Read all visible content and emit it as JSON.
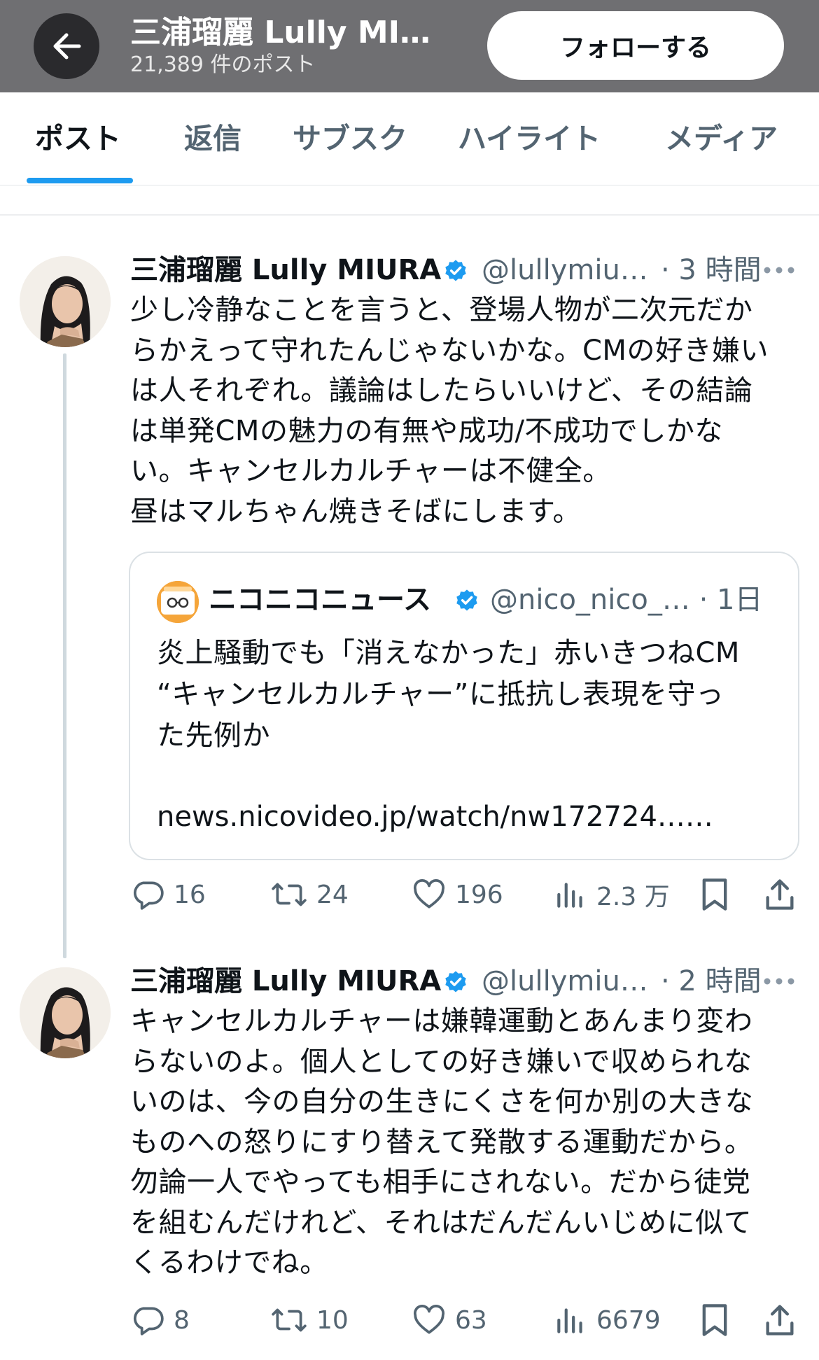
{
  "header": {
    "name": "三浦瑠麗 Lully MI…",
    "post_count": "21,389 件のポスト",
    "follow_label": "フォローする"
  },
  "tabs": [
    {
      "label": "ポスト",
      "active": true
    },
    {
      "label": "返信"
    },
    {
      "label": "サブスク"
    },
    {
      "label": "ハイライト"
    },
    {
      "label": "メディア"
    }
  ],
  "tweets": [
    {
      "name": "三浦瑠麗 Lully MIURA",
      "handle": "@lullymiu…",
      "time": "· 3 時間",
      "text": "少し冷静なことを言うと、登場人物が二次元だか\nらかえって守れたんじゃないかな。CMの好き嫌い\nは人それぞれ。議論はしたらいいけど、その結論\nは単発CMの魅力の有無や成功/不成功でしかな\nい。キャンセルカルチャーは不健全。\n昼はマルちゃん焼きそばにします。",
      "quote": {
        "name": "ニコニコニュース",
        "handle": "@nico_nico_… · 1日",
        "text": "炎上騒動でも「消えなかった」赤いきつねCM\n“キャンセルカルチャー”に抵抗し表現を守っ\nた先例か",
        "link": "news.nicovideo.jp/watch/nw172724……"
      },
      "stats": {
        "replies": "16",
        "reposts": "24",
        "likes": "196",
        "views": "2.3 万"
      }
    },
    {
      "name": "三浦瑠麗 Lully MIURA",
      "handle": "@lullymiu…",
      "time": "· 2 時間",
      "text": "キャンセルカルチャーは嫌韓運動とあんまり変わ\nらないのよ。個人としての好き嫌いで収められな\nいのは、今の自分の生きにくさを何か別の大きな\nものへの怒りにすり替えて発散する運動だから。\n勿論一人でやっても相手にされない。だから徒党\nを組むんだけれど、それはだんだんいじめに似て\nくるわけでね。",
      "stats": {
        "replies": "8",
        "reposts": "10",
        "likes": "63",
        "views": "6679"
      }
    }
  ],
  "colors": {
    "accent": "#1d9bf0",
    "header_bg": "#6f6f72",
    "secondary_text": "#536471"
  }
}
